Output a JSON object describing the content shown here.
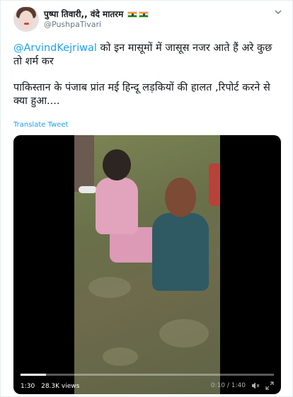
{
  "tweet": {
    "author_name": "पुष्पा तिवारी,, वंदे मातरम",
    "handle": "@PushpaTivari",
    "mention": "@ArvindKejriwal",
    "line1_rest": " को इन मासूमों में जासूस नजर आते हैं अरे कुछ तो शर्म कर",
    "paragraph2": "पाकिस्तान के पंजाब प्रांत मई हिन्दू लड़कियों की हालत ,रिपोर्ट करने से क्या हुआ....",
    "translate_label": "Translate Tweet",
    "flag_icons": [
      "indian-flag-icon",
      "indian-flag-icon"
    ]
  },
  "video": {
    "elapsed_label": "1:30",
    "views_label": "28.3K views",
    "time_label": "0:10 / 1:40",
    "progress": 0.1,
    "icons": [
      "volume-muted-icon",
      "fullscreen-icon"
    ]
  },
  "colors": {
    "link": "#1da1f2",
    "text": "#14171a",
    "muted": "#657786"
  }
}
